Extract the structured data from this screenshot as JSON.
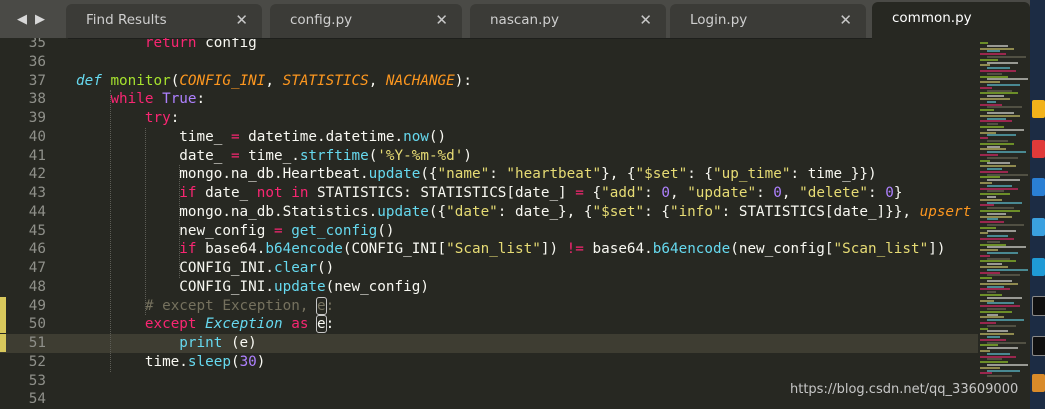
{
  "tabs": [
    {
      "label": "Find Results",
      "close": "✕",
      "active": false
    },
    {
      "label": "config.py",
      "close": "✕",
      "active": false
    },
    {
      "label": "nascan.py",
      "close": "✕",
      "active": false
    },
    {
      "label": "Login.py",
      "close": "✕",
      "active": false
    },
    {
      "label": "common.py",
      "close": "",
      "active": true
    }
  ],
  "nav": {
    "back_icon": "◀",
    "forward_icon": "▶"
  },
  "lines": [
    {
      "n": "35",
      "tokens": [
        [
          "        ",
          ""
        ],
        [
          "return",
          "kw"
        ],
        [
          " config",
          ""
        ]
      ]
    },
    {
      "n": "36",
      "tokens": []
    },
    {
      "n": "37",
      "tokens": [
        [
          "def",
          "def"
        ],
        [
          " ",
          ""
        ],
        [
          "monitor",
          "fn"
        ],
        [
          "(",
          ""
        ],
        [
          "CONFIG_INI",
          "param"
        ],
        [
          ", ",
          ""
        ],
        [
          "STATISTICS",
          "param"
        ],
        [
          ", ",
          ""
        ],
        [
          "NACHANGE",
          "param"
        ],
        [
          "):",
          ""
        ]
      ]
    },
    {
      "n": "38",
      "tokens": [
        [
          "    ",
          ""
        ],
        [
          "while",
          "kw"
        ],
        [
          " ",
          ""
        ],
        [
          "True",
          "const"
        ],
        [
          ":",
          ""
        ]
      ]
    },
    {
      "n": "39",
      "tokens": [
        [
          "        ",
          ""
        ],
        [
          "try",
          "kw"
        ],
        [
          ":",
          ""
        ]
      ]
    },
    {
      "n": "40",
      "tokens": [
        [
          "            time_ ",
          ""
        ],
        [
          "=",
          "kw"
        ],
        [
          " datetime.datetime.",
          ""
        ],
        [
          "now",
          "call"
        ],
        [
          "()",
          ""
        ]
      ]
    },
    {
      "n": "41",
      "tokens": [
        [
          "            date_ ",
          ""
        ],
        [
          "=",
          "kw"
        ],
        [
          " time_.",
          ""
        ],
        [
          "strftime",
          "call"
        ],
        [
          "(",
          ""
        ],
        [
          "'%Y-%m-%d'",
          "str"
        ],
        [
          ")",
          ""
        ]
      ]
    },
    {
      "n": "42",
      "tokens": [
        [
          "            mongo.na_db.Heartbeat.",
          ""
        ],
        [
          "update",
          "call"
        ],
        [
          "({",
          ""
        ],
        [
          "\"name\"",
          "str"
        ],
        [
          ": ",
          ""
        ],
        [
          "\"heartbeat\"",
          "str"
        ],
        [
          "}, {",
          ""
        ],
        [
          "\"$set\"",
          "str"
        ],
        [
          ": {",
          ""
        ],
        [
          "\"up_time\"",
          "str"
        ],
        [
          ": time_}})",
          ""
        ]
      ]
    },
    {
      "n": "43",
      "tokens": [
        [
          "            ",
          ""
        ],
        [
          "if",
          "kw"
        ],
        [
          " date_ ",
          ""
        ],
        [
          "not",
          "kw"
        ],
        [
          " ",
          ""
        ],
        [
          "in",
          "kw"
        ],
        [
          " STATISTICS: STATISTICS[date_] ",
          ""
        ],
        [
          "=",
          "kw"
        ],
        [
          " {",
          ""
        ],
        [
          "\"add\"",
          "str"
        ],
        [
          ": ",
          ""
        ],
        [
          "0",
          "num"
        ],
        [
          ", ",
          ""
        ],
        [
          "\"update\"",
          "str"
        ],
        [
          ": ",
          ""
        ],
        [
          "0",
          "num"
        ],
        [
          ", ",
          ""
        ],
        [
          "\"delete\"",
          "str"
        ],
        [
          ": ",
          ""
        ],
        [
          "0",
          "num"
        ],
        [
          "}",
          ""
        ]
      ]
    },
    {
      "n": "44",
      "tokens": [
        [
          "            mongo.na_db.Statistics.",
          ""
        ],
        [
          "update",
          "call"
        ],
        [
          "({",
          ""
        ],
        [
          "\"date\"",
          "str"
        ],
        [
          ": date_}, {",
          ""
        ],
        [
          "\"$set\"",
          "str"
        ],
        [
          ": {",
          ""
        ],
        [
          "\"info\"",
          "str"
        ],
        [
          ": STATISTICS[date_]}}, ",
          ""
        ],
        [
          "upsert",
          "param"
        ]
      ]
    },
    {
      "n": "45",
      "tokens": [
        [
          "            new_config ",
          ""
        ],
        [
          "=",
          "kw"
        ],
        [
          " ",
          ""
        ],
        [
          "get_config",
          "call"
        ],
        [
          "()",
          ""
        ]
      ]
    },
    {
      "n": "46",
      "tokens": [
        [
          "            ",
          ""
        ],
        [
          "if",
          "kw"
        ],
        [
          " base64.",
          ""
        ],
        [
          "b64encode",
          "call"
        ],
        [
          "(CONFIG_INI[",
          ""
        ],
        [
          "\"Scan_list\"",
          "str"
        ],
        [
          "]) ",
          ""
        ],
        [
          "!=",
          "kw"
        ],
        [
          " base64.",
          ""
        ],
        [
          "b64encode",
          "call"
        ],
        [
          "(new_config[",
          ""
        ],
        [
          "\"Scan_list\"",
          "str"
        ],
        [
          "])",
          ""
        ]
      ]
    },
    {
      "n": "47",
      "tokens": [
        [
          "            CONFIG_INI.",
          ""
        ],
        [
          "clear",
          "call"
        ],
        [
          "()",
          ""
        ]
      ]
    },
    {
      "n": "48",
      "tokens": [
        [
          "            CONFIG_INI.",
          ""
        ],
        [
          "update",
          "call"
        ],
        [
          "(new_config)",
          ""
        ]
      ]
    },
    {
      "n": "49",
      "tokens": [
        [
          "        ",
          ""
        ],
        [
          "# except Exception, ",
          "cmt"
        ],
        [
          "e",
          "cmt boxed"
        ],
        [
          ":",
          "cmt"
        ]
      ]
    },
    {
      "n": "50",
      "tokens": [
        [
          "        ",
          ""
        ],
        [
          "except",
          "kw"
        ],
        [
          " ",
          ""
        ],
        [
          "Exception",
          "cls"
        ],
        [
          " ",
          ""
        ],
        [
          "as",
          "kw"
        ],
        [
          " ",
          ""
        ],
        [
          "e",
          "boxed"
        ],
        [
          ":",
          ""
        ]
      ]
    },
    {
      "n": "51",
      "tokens": [
        [
          "            ",
          ""
        ],
        [
          "print",
          "call"
        ],
        [
          " (e)",
          ""
        ]
      ]
    },
    {
      "n": "52",
      "tokens": [
        [
          "        time.",
          ""
        ],
        [
          "sleep",
          "call"
        ],
        [
          "(",
          ""
        ],
        [
          "30",
          "num"
        ],
        [
          ")",
          ""
        ]
      ]
    },
    {
      "n": "53",
      "tokens": []
    },
    {
      "n": "54",
      "tokens": []
    }
  ],
  "watermark": "https://blog.csdn.net/qq_33609000"
}
